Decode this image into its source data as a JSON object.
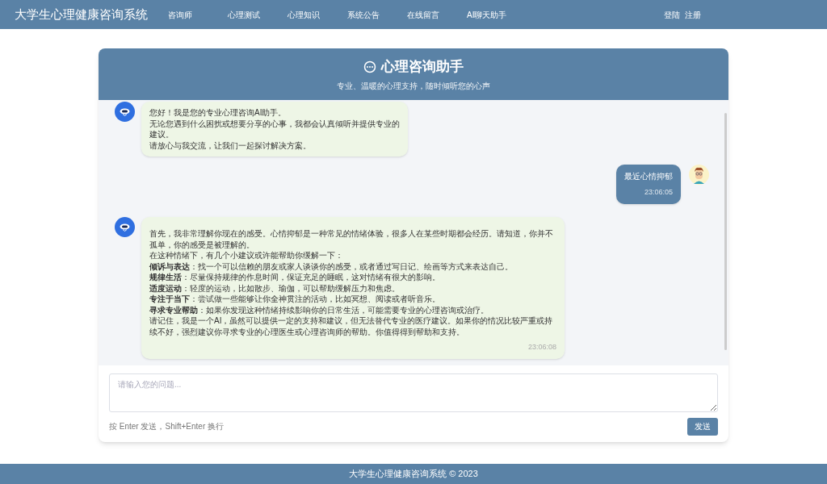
{
  "navbar": {
    "brand": "大学生心理健康咨询系统",
    "links": [
      "咨询师",
      "心理测试",
      "心理知识",
      "系统公告",
      "在线留言",
      "AI聊天助手"
    ],
    "auth": [
      "登陆",
      "注册"
    ]
  },
  "chat": {
    "title": "心理咨询助手",
    "subtitle": "专业、温暖的心理支持，随时倾听您的心声",
    "messages": [
      {
        "kind": "ai",
        "lines": [
          "您好！我是您的专业心理咨询AI助手。",
          "无论您遇到什么困扰或想要分享的心事，我都会认真倾听并提供专业的建议。",
          "请放心与我交流，让我们一起探讨解决方案。"
        ]
      },
      {
        "kind": "user",
        "lines": [
          "最近心情抑郁"
        ],
        "time": "23:06:05"
      },
      {
        "kind": "ai",
        "lines": [
          "首先，我非常理解你现在的感受。心情抑郁是一种常见的情绪体验，很多人在某些时期都会经历。请知道，你并不孤单，你的感受是被理解的。",
          "在这种情绪下，有几个小建议或许能帮助你缓解一下：",
          "**倾诉与表达**：找一个可以信赖的朋友或家人谈谈你的感受，或者通过写日记、绘画等方式来表达自己。",
          "**规律生活**：尽量保持规律的作息时间，保证充足的睡眠，这对情绪有很大的影响。",
          "**适度运动**：轻度的运动，比如散步、瑜伽，可以帮助缓解压力和焦虑。",
          "**专注于当下**：尝试做一些能够让你全神贯注的活动，比如冥想、阅读或者听音乐。",
          "**寻求专业帮助**：如果你发现这种情绪持续影响你的日常生活，可能需要专业的心理咨询或治疗。",
          "请记住，我是一个AI，虽然可以提供一定的支持和建议，但无法替代专业的医疗建议。如果你的情况比较严重或持续不好，强烈建议你寻求专业的心理医生或心理咨询师的帮助。你值得得到帮助和支持。"
        ],
        "time": "23:06:08"
      }
    ],
    "input": {
      "placeholder": "请输入您的问题..."
    },
    "hint": "按 Enter 发送，Shift+Enter 换行",
    "send_button": "发送"
  },
  "footer": "大学生心理健康咨询系统 © 2023"
}
